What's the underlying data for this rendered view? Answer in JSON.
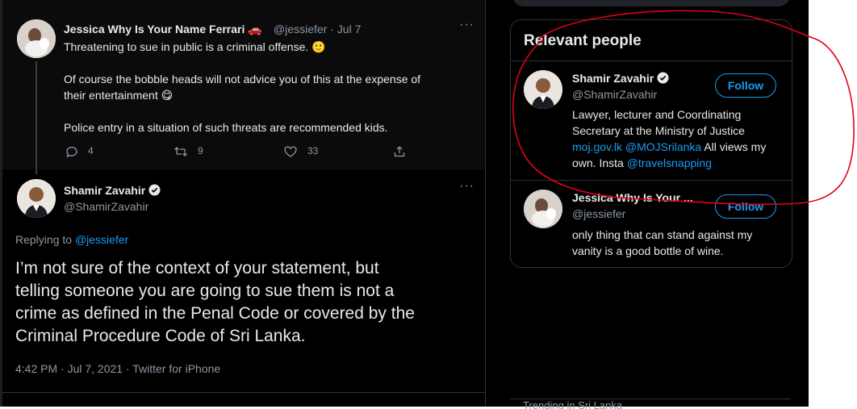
{
  "parent_tweet": {
    "name": "Jessica Why Is Your Name Ferrari 🚗",
    "handle_date": "@jessiefer · Jul 7",
    "lines": [
      "Threatening to sue in public is a criminal offense. 🙂",
      "Of course the bobble heads will not advice you of this at the expense of",
      "their entertainment 😋",
      "Police entry in a situation of such threats are recommended kids."
    ],
    "replies": "4",
    "retweets": "9",
    "likes": "33",
    "avatar_icon": "avatar-photo"
  },
  "main_tweet": {
    "name": "Shamir Zavahir",
    "handle": "@ShamirZavahir",
    "replying_prefix": "Replying to",
    "replying_to": "@jessiefer",
    "text_lines": [
      "I’m not sure of the context of your statement, but",
      "telling someone you are going to sue them is not a",
      "crime as defined in the Penal Code or covered by the",
      "Criminal Procedure Code of Sri Lanka."
    ],
    "timestamp": "4:42 PM · Jul 7, 2021 · Twitter for iPhone"
  },
  "relevant_people": {
    "title": "Relevant people",
    "people": [
      {
        "name": "Shamir Zavahir",
        "handle": "@ShamirZavahir",
        "follow_label": "Follow",
        "bio_line1": "Lawyer, lecturer and Coordinating",
        "bio_line2": "Secretary at the Ministry of Justice",
        "bio_link1": "moj.gov.lk",
        "bio_link2": "@MOJSrilanka",
        "bio_rest3": " All views my",
        "bio_line4_prefix": "own. Insta ",
        "bio_link3": "@travelsnapping"
      },
      {
        "name": "Jessica Why Is Your ...",
        "handle": "@jessiefer",
        "follow_label": "Follow",
        "bio_line1": "only thing that can stand against my",
        "bio_line2": "vanity is a good bottle of wine."
      }
    ]
  },
  "trending_stub": "Trending in Sri Lanka",
  "colors": {
    "accent": "#1d9bf0",
    "annotation": "#e0001a",
    "background": "#000000"
  }
}
